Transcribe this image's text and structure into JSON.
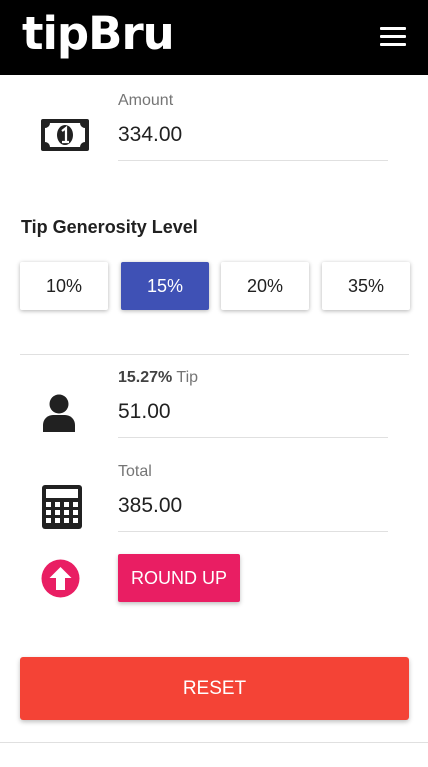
{
  "header": {
    "logo": "tipBru",
    "menu_icon": "hamburger-menu-icon"
  },
  "amount": {
    "label": "Amount",
    "value": "334.00",
    "icon": "money-bill-icon"
  },
  "tip_section": {
    "title": "Tip Generosity Level",
    "options": [
      {
        "label": "10%",
        "selected": false
      },
      {
        "label": "15%",
        "selected": true
      },
      {
        "label": "20%",
        "selected": false
      },
      {
        "label": "35%",
        "selected": false
      }
    ]
  },
  "tip_result": {
    "percent": "15.27%",
    "suffix": "Tip",
    "value": "51.00",
    "icon": "user-icon"
  },
  "total": {
    "label": "Total",
    "value": "385.00",
    "icon": "calculator-icon"
  },
  "round_up": {
    "label": "ROUND UP",
    "icon": "arrow-up-circle-icon"
  },
  "reset": {
    "label": "RESET"
  },
  "colors": {
    "header_bg": "#000000",
    "primary": "#3f51b5",
    "accent": "#e91e63",
    "reset": "#f44336"
  }
}
